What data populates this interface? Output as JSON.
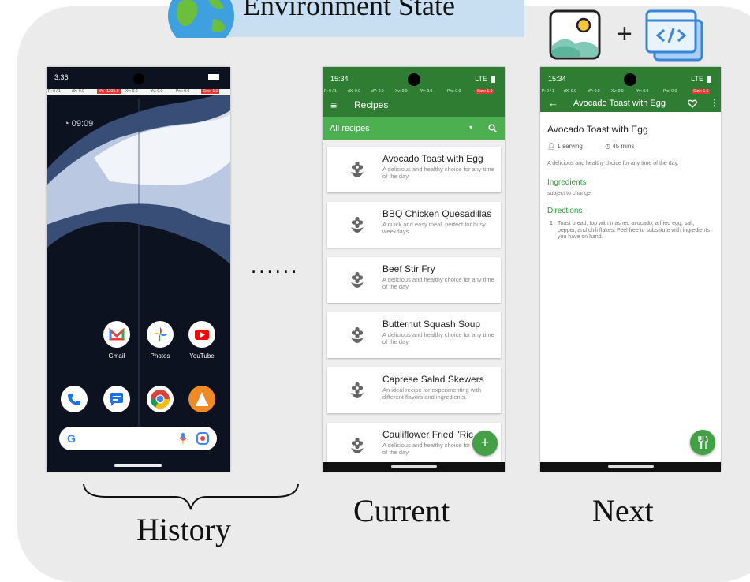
{
  "header": {
    "title": "Environment State"
  },
  "labels": {
    "history": "History",
    "current": "Current",
    "next": "Next",
    "plus": "+",
    "ellipsis": "......"
  },
  "colors": {
    "panel": "#ebebeb",
    "title_box": "#c7dff0",
    "app_green": "#2e7d32",
    "app_green_light": "#4caf50"
  },
  "history_phone": {
    "status_time": "3:36",
    "debug_bar": [
      "P: 0 / 1",
      "dX: 0.0",
      "dY: -1235.9",
      "Xv: 0.0",
      "Yv: 0.0",
      "Prs: 0.0",
      "Size: 1.0"
    ],
    "clock": "09:09",
    "apps_row1": [
      {
        "label": "Gmail",
        "icon": "gmail-icon"
      },
      {
        "label": "Photos",
        "icon": "photos-icon"
      },
      {
        "label": "YouTube",
        "icon": "youtube-icon"
      }
    ],
    "dock_icons": [
      "phone-icon",
      "messages-icon",
      "chrome-icon",
      "vlc-icon"
    ],
    "search_icons": [
      "google-icon",
      "mic-icon",
      "lens-icon"
    ]
  },
  "current_phone": {
    "status_time": "15:34",
    "status_right": "LTE",
    "debug_bar": [
      "P: 0 / 1",
      "dX: 0.0",
      "dY: 0.0",
      "Xv: 0.0",
      "Yv: 0.0",
      "Prs: 0.0",
      "Size: 1.0"
    ],
    "toolbar_title": "Recipes",
    "filter_label": "All recipes",
    "recipes": [
      {
        "title": "Avocado Toast with Egg",
        "desc": "A delicious and healthy choice for any time of the day."
      },
      {
        "title": "BBQ Chicken Quesadillas",
        "desc": "A quick and easy meal, perfect for busy weekdays."
      },
      {
        "title": "Beef Stir Fry",
        "desc": "A delicious and healthy choice for any time of the day."
      },
      {
        "title": "Butternut Squash Soup",
        "desc": "A delicious and healthy choice for any time of the day."
      },
      {
        "title": "Caprese Salad Skewers",
        "desc": "An ideal recipe for experimenting with different flavors and ingredients."
      },
      {
        "title": "Cauliflower Fried \"Ric",
        "desc": "A delicious and healthy choice for any time of the day."
      }
    ],
    "fab_label": "+"
  },
  "next_phone": {
    "status_time": "15:34",
    "status_right": "LTE",
    "debug_bar": [
      "P: 0 / 1",
      "dX: 0.0",
      "dY: 0.0",
      "Xv: 0.0",
      "Yv: 0.0",
      "Prs: 0.0",
      "Size: 1.0"
    ],
    "toolbar_title": "Avocado Toast with Egg",
    "recipe_title": "Avocado Toast with Egg",
    "servings": "1 serving",
    "time": "45 mins",
    "description": "A delicious and healthy choice for any time of the day.",
    "ingredients_heading": "Ingredients",
    "ingredients_text": "subject to change",
    "directions_heading": "Directions",
    "direction_number": "1",
    "direction_text": "Toast bread, top with mashed avocado, a fried egg, salt, pepper, and chili flakes. Feel free to substitute with ingredients you have on hand."
  }
}
